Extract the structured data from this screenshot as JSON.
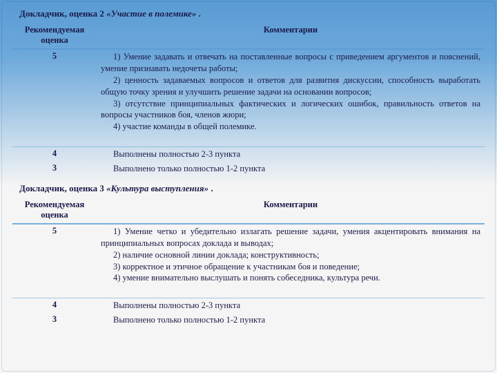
{
  "section1": {
    "title_prefix": "Докладчик, оценка 2 ",
    "title_italic": "«Участие в полемике»",
    "title_suffix": " .",
    "header_score": "Рекомендуемая оценка",
    "header_comment": "Комментарии",
    "rows": {
      "r5_score": "5",
      "r5_comment_1": "1) Умение задавать и отвечать на поставленные вопросы с приведением аргументов и пояснений, умение признавать недочеты работы;",
      "r5_comment_2": "2) ценность задаваемых вопросов и ответов для развития дискуссии, способность выработать общую точку зрения и улучшить решение задачи на основании вопросов;",
      "r5_comment_3": "3) отсутствие принципиальных фактических и логических ошибок, правильность ответов на вопросы участников боя, членов жюри;",
      "r5_comment_4": "4) участие команды в общей полемике.",
      "r4_score": "4",
      "r4_comment": "Выполнены полностью 2-3 пункта",
      "r3_score": "3",
      "r3_comment": "Выполнено только полностью 1-2 пункта"
    }
  },
  "section2": {
    "title_prefix": "Докладчик, оценка 3 ",
    "title_italic": "«Культура выступления»",
    "title_suffix": " .",
    "header_score": "Рекомендуемая оценка",
    "header_comment": "Комментарии",
    "rows": {
      "r5_score": "5",
      "r5_comment_1": "1) Умение четко и убедительно излагать решение задачи, умения акцентировать внимания на принципиальных вопросах доклада и выводах;",
      "r5_comment_2": "2) наличие основной линии доклада; конструктивность;",
      "r5_comment_3": "3) корректное и этичное обращение к участникам боя и поведение;",
      "r5_comment_4": "4) умение внимательно выслушать и понять собеседника, культура речи.",
      "r4_score": "4",
      "r4_comment": "Выполнены полностью 2-3 пункта",
      "r3_score": "3",
      "r3_comment": "Выполнено только полностью 1-2 пункта"
    }
  }
}
